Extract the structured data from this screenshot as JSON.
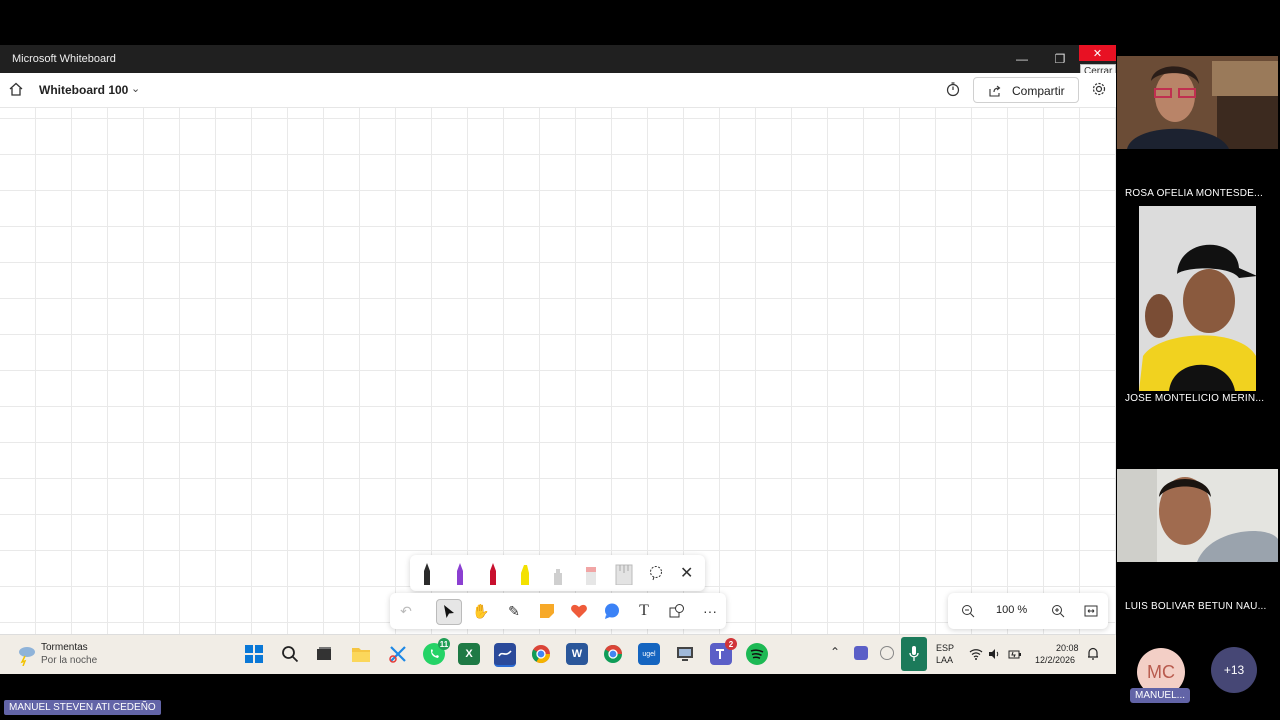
{
  "window": {
    "title": "Microsoft Whiteboard",
    "close_tooltip": "Cerrar"
  },
  "appbar": {
    "board_name": "Whiteboard 100",
    "share_label": "Compartir",
    "icons": [
      "home-icon",
      "chevron-down-icon",
      "timer-icon",
      "share-icon",
      "gear-icon"
    ]
  },
  "pen_tray": {
    "pens": [
      {
        "name": "black-pen",
        "color": "#1a1a1a"
      },
      {
        "name": "purple-pen",
        "color": "#8b3fd1"
      },
      {
        "name": "red-pen",
        "color": "#c8102e"
      },
      {
        "name": "yellow-highlighter",
        "color": "#f3e100"
      },
      {
        "name": "eraser",
        "color": "#cccccc"
      },
      {
        "name": "pink-eraser",
        "color": "#f1a5a5"
      },
      {
        "name": "ruler",
        "color": "#d9d9d9"
      }
    ]
  },
  "toolbar": {
    "tools": [
      "undo-icon",
      "select-icon",
      "hand-icon",
      "pen-icon",
      "sticky-note-icon",
      "reaction-icon",
      "comment-icon",
      "text-icon",
      "shapes-icon",
      "more-icon"
    ],
    "text_glyph": "T",
    "more_glyph": "···"
  },
  "zoom": {
    "value": "100 %"
  },
  "taskbar": {
    "weather_title": "Tormentas",
    "weather_sub": "Por la noche",
    "lang_top": "ESP",
    "lang_bottom": "LAA",
    "time": "20:08",
    "date": "12/2/2026",
    "badges": {
      "whatsapp": "11",
      "teams": "2"
    },
    "app_letters": {
      "excel": "X",
      "word": "W",
      "ugel": "ugel"
    }
  },
  "participants": {
    "people": [
      {
        "name": "ROSA OFELIA MONTESDE..."
      },
      {
        "name": "JOSE MONTELICIO MERIN..."
      },
      {
        "name": "LUIS BOLIVAR BETUN NAU..."
      }
    ],
    "self": {
      "initials": "MC",
      "label": "MANUEL..."
    },
    "overflow": "+13",
    "presenter": "MANUEL STEVEN ATI CEDEÑO"
  },
  "colors": {
    "accent": "#6264a7",
    "close": "#e81123",
    "canvas": "#ffffff"
  }
}
